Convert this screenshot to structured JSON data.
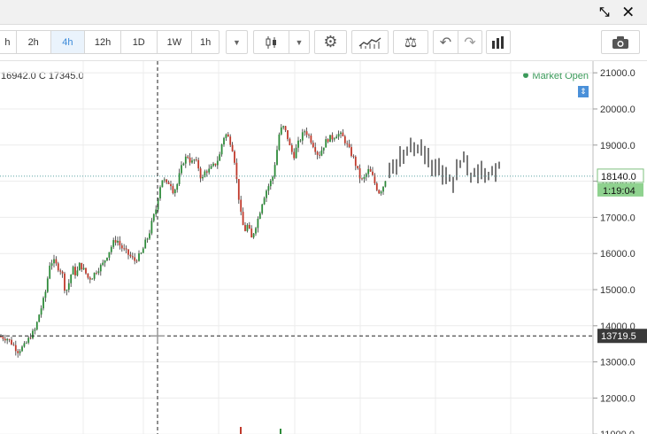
{
  "window": {
    "controls": "⤡ ✕"
  },
  "toolbar": {
    "intervals": [
      "h",
      "2h",
      "4h",
      "12h",
      "1D",
      "1W"
    ],
    "active_interval": "4h",
    "interval_dropdown": "1h",
    "icons": [
      "candles-icon",
      "gear-icon",
      "indicators-icon",
      "balance-icon",
      "undo-icon",
      "redo-icon",
      "bar-chart-icon",
      "camera-icon"
    ]
  },
  "legend": {
    "ohlc_text": "16942.0  C  17345.0",
    "market_status": "Market Open"
  },
  "chart_data": {
    "type": "candlestick",
    "y_axis_labels": [
      "21000.0",
      "20000.0",
      "19000.0",
      "18000.0",
      "17000.0",
      "16000.0",
      "15000.0",
      "14000.0",
      "13000.0",
      "12000.0",
      "11000.0"
    ],
    "ylim": [
      10900,
      21300
    ],
    "current_price": "18140.0",
    "countdown": "1:19:04",
    "crosshair_price": "13719.5",
    "crosshair_value": 13719.5,
    "current_value": 18140,
    "colors": {
      "up": "#2e8b3a",
      "down": "#c0392b",
      "wick": "#333333",
      "price_line": "#5aa3a3"
    },
    "grid": true,
    "path": [
      [
        0,
        13700
      ],
      [
        8,
        13650
      ],
      [
        14,
        13500
      ],
      [
        20,
        13300
      ],
      [
        28,
        13450
      ],
      [
        34,
        13700
      ],
      [
        40,
        13900
      ],
      [
        44,
        14300
      ],
      [
        48,
        14600
      ],
      [
        52,
        15000
      ],
      [
        56,
        15700
      ],
      [
        60,
        15800
      ],
      [
        66,
        15600
      ],
      [
        70,
        15500
      ],
      [
        74,
        14900
      ],
      [
        78,
        15200
      ],
      [
        82,
        15600
      ],
      [
        86,
        15400
      ],
      [
        90,
        15700
      ],
      [
        96,
        15500
      ],
      [
        100,
        15300
      ],
      [
        104,
        15350
      ],
      [
        108,
        15500
      ],
      [
        112,
        15600
      ],
      [
        116,
        15700
      ],
      [
        120,
        15900
      ],
      [
        124,
        16100
      ],
      [
        128,
        16300
      ],
      [
        132,
        16400
      ],
      [
        136,
        16200
      ],
      [
        140,
        16100
      ],
      [
        144,
        16000
      ],
      [
        148,
        15900
      ],
      [
        152,
        15800
      ],
      [
        156,
        15900
      ],
      [
        160,
        16000
      ],
      [
        164,
        16300
      ],
      [
        168,
        16500
      ],
      [
        172,
        16900
      ],
      [
        176,
        17200
      ],
      [
        180,
        17800
      ],
      [
        184,
        18100
      ],
      [
        188,
        17900
      ],
      [
        192,
        18000
      ],
      [
        196,
        17700
      ],
      [
        200,
        17900
      ],
      [
        204,
        18300
      ],
      [
        208,
        18600
      ],
      [
        212,
        18700
      ],
      [
        216,
        18500
      ],
      [
        220,
        18600
      ],
      [
        224,
        18400
      ],
      [
        228,
        18000
      ],
      [
        232,
        18300
      ],
      [
        236,
        18300
      ],
      [
        240,
        18400
      ],
      [
        244,
        18500
      ],
      [
        248,
        18700
      ],
      [
        252,
        19200
      ],
      [
        256,
        19300
      ],
      [
        260,
        19100
      ],
      [
        264,
        18800
      ],
      [
        268,
        17900
      ],
      [
        272,
        17100
      ],
      [
        276,
        16600
      ],
      [
        280,
        16800
      ],
      [
        284,
        16400
      ],
      [
        288,
        16700
      ],
      [
        292,
        17000
      ],
      [
        296,
        17400
      ],
      [
        300,
        17700
      ],
      [
        304,
        17900
      ],
      [
        308,
        18100
      ],
      [
        312,
        18700
      ],
      [
        316,
        19400
      ],
      [
        320,
        19500
      ],
      [
        324,
        19300
      ],
      [
        328,
        18900
      ],
      [
        332,
        18700
      ],
      [
        336,
        19000
      ],
      [
        340,
        19200
      ],
      [
        344,
        19400
      ],
      [
        348,
        19300
      ],
      [
        352,
        19100
      ],
      [
        356,
        18900
      ],
      [
        360,
        18700
      ],
      [
        364,
        18900
      ],
      [
        368,
        19100
      ],
      [
        372,
        19200
      ],
      [
        376,
        19200
      ],
      [
        380,
        19300
      ],
      [
        384,
        19300
      ],
      [
        388,
        19200
      ],
      [
        392,
        19000
      ],
      [
        396,
        18800
      ],
      [
        400,
        18600
      ],
      [
        404,
        18300
      ],
      [
        408,
        18000
      ],
      [
        412,
        18100
      ],
      [
        416,
        18300
      ],
      [
        420,
        18200
      ],
      [
        424,
        17900
      ],
      [
        428,
        17700
      ],
      [
        432,
        17800
      ],
      [
        436,
        18100
      ]
    ],
    "projection": [
      [
        440,
        18400
      ],
      [
        448,
        18500
      ],
      [
        456,
        18700
      ],
      [
        464,
        18900
      ],
      [
        472,
        19000
      ],
      [
        480,
        18800
      ],
      [
        488,
        18400
      ],
      [
        496,
        18300
      ],
      [
        504,
        18100
      ],
      [
        510,
        17900
      ],
      [
        516,
        18200
      ],
      [
        522,
        18700
      ],
      [
        528,
        18400
      ],
      [
        534,
        18100
      ],
      [
        540,
        18300
      ],
      [
        546,
        18200
      ],
      [
        552,
        18100
      ],
      [
        558,
        18300
      ],
      [
        564,
        18400
      ]
    ]
  }
}
